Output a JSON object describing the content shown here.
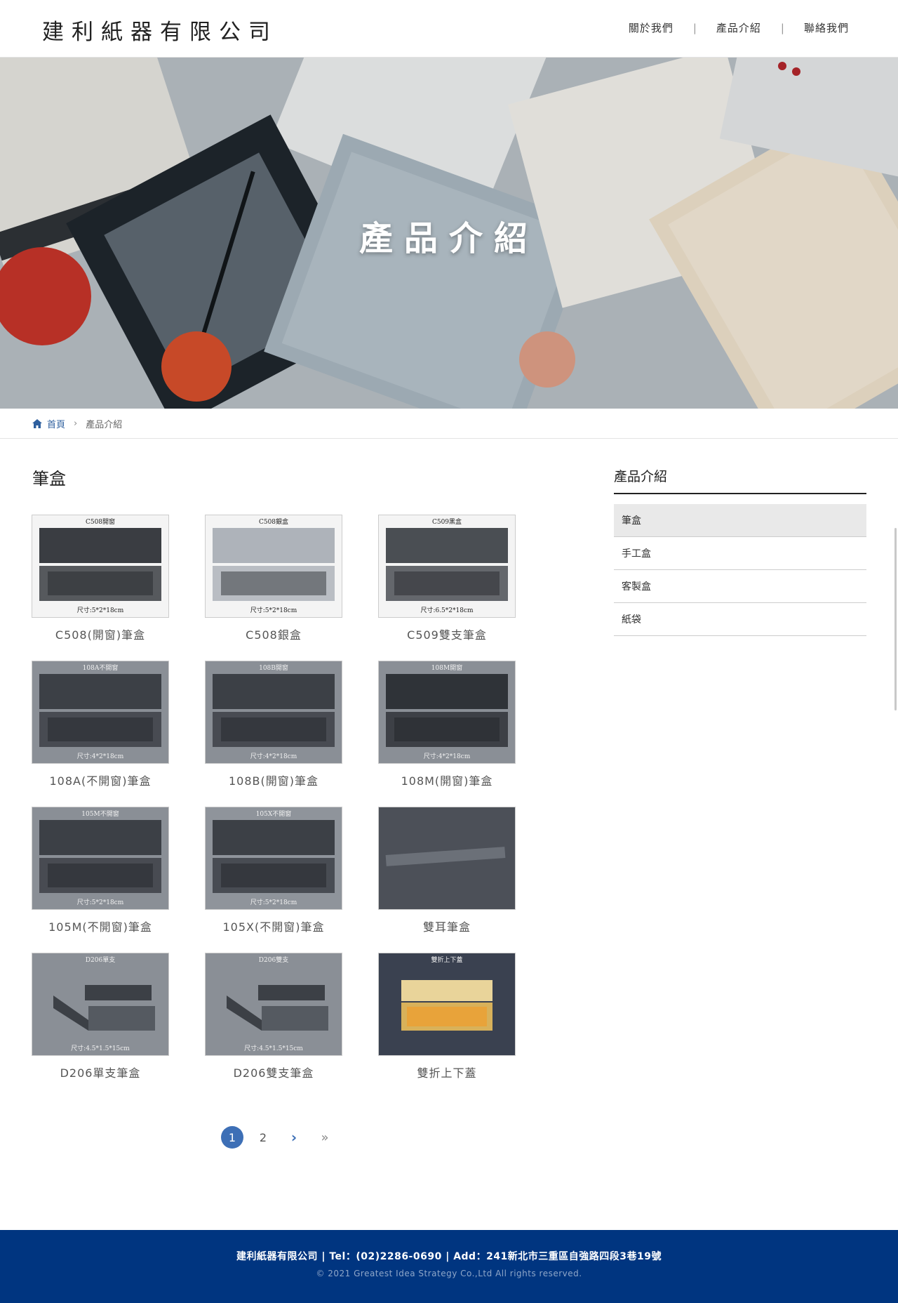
{
  "header": {
    "logo": "建利紙器有限公司",
    "nav": [
      {
        "label": "關於我們"
      },
      {
        "label": "產品介紹"
      },
      {
        "label": "聯絡我們"
      }
    ],
    "separator": "|"
  },
  "hero": {
    "title": "產品介紹"
  },
  "breadcrumb": {
    "home": "首頁",
    "arrow": "›",
    "current": "產品介紹"
  },
  "main": {
    "section_title": "筆盒",
    "products": [
      {
        "caption": "C508(開窗)筆盒",
        "photo_label": "C508開窗",
        "size_label": "尺寸:5*2*18cm",
        "bg": "#f4f4f4",
        "box": "#3a3d42"
      },
      {
        "caption": "C508銀盒",
        "photo_label": "C508銀盒",
        "size_label": "尺寸:5*2*18cm",
        "bg": "#f4f4f4",
        "box": "#aeb3ba"
      },
      {
        "caption": "C509雙支筆盒",
        "photo_label": "C509黑盒",
        "size_label": "尺寸:6.5*2*18cm",
        "bg": "#f4f4f4",
        "box": "#4a4e53"
      },
      {
        "caption": "108A(不開窗)筆盒",
        "photo_label": "108A不開窗",
        "size_label": "尺寸:4*2*18cm",
        "bg": "#8a8f96",
        "box": "#3c4046"
      },
      {
        "caption": "108B(開窗)筆盒",
        "photo_label": "108B開窗",
        "size_label": "尺寸:4*2*18cm",
        "bg": "#8a8f96",
        "box": "#3c4046"
      },
      {
        "caption": "108M(開窗)筆盒",
        "photo_label": "108M開窗",
        "size_label": "尺寸:4*2*18cm",
        "bg": "#8a8f96",
        "box": "#2f3338"
      },
      {
        "caption": "105M(不開窗)筆盒",
        "photo_label": "105M不開窗",
        "size_label": "尺寸:5*2*18cm",
        "bg": "#8a8f96",
        "box": "#3c4046"
      },
      {
        "caption": "105X(不開窗)筆盒",
        "photo_label": "105X不開窗",
        "size_label": "尺寸:5*2*18cm",
        "bg": "#8f949b",
        "box": "#3c4046"
      },
      {
        "caption": "雙耳筆盒",
        "photo_label": "",
        "size_label": "",
        "bg": "#4c5058",
        "box": "#6b7078"
      },
      {
        "caption": "D206單支筆盒",
        "photo_label": "D206單支",
        "size_label": "尺寸:4.5*1.5*15cm",
        "bg": "#8a8f96",
        "box": "#3c4046"
      },
      {
        "caption": "D206雙支筆盒",
        "photo_label": "D206雙支",
        "size_label": "尺寸:4.5*1.5*15cm",
        "bg": "#8a8f96",
        "box": "#3c4046"
      },
      {
        "caption": "雙折上下蓋",
        "photo_label": "雙折上下蓋",
        "size_label": "",
        "bg": "#3a4150",
        "box": "#d8b15a"
      }
    ]
  },
  "pagination": {
    "pages": [
      "1",
      "2"
    ],
    "active": "1",
    "next": "›",
    "last": "»"
  },
  "sidebar": {
    "title": "產品介紹",
    "items": [
      {
        "label": "筆盒"
      },
      {
        "label": "手工盒"
      },
      {
        "label": "客製盒"
      },
      {
        "label": "紙袋"
      }
    ]
  },
  "footer": {
    "line1": "建利紙器有限公司 | Tel：(02)2286-0690 | Add：241新北市三重區自強路四段3巷19號",
    "line2": "© 2021 Greatest Idea Strategy Co.,Ltd All rights reserved."
  }
}
